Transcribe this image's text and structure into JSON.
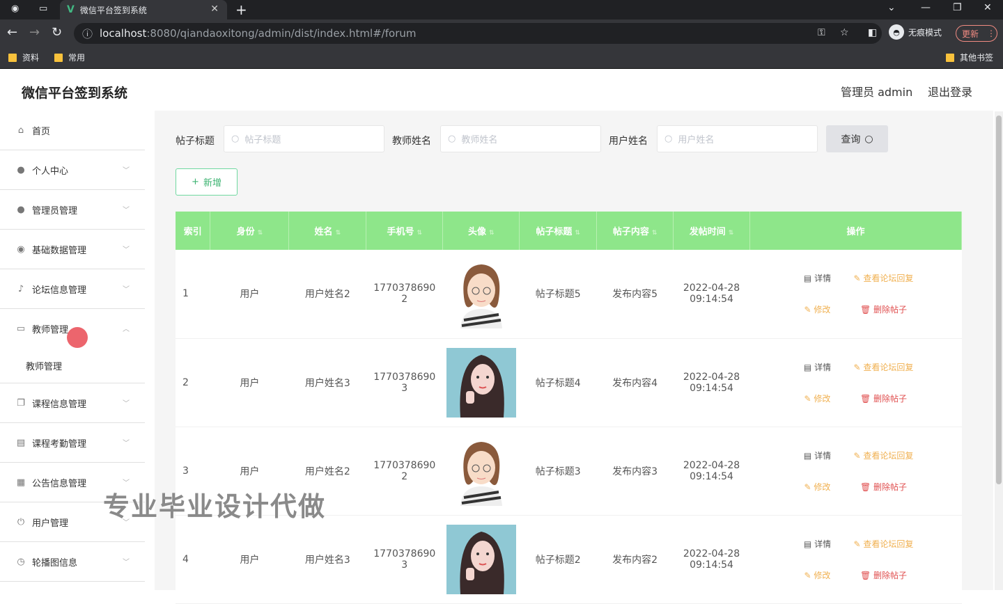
{
  "browser": {
    "tab_title": "微信平台签到系统",
    "url_host": "localhost",
    "url_rest": ":8080/qiandaoxitong/admin/dist/index.html#/forum",
    "incognito_label": "无痕模式",
    "update_label": "更新",
    "bookmarks": [
      "资料",
      "常用"
    ],
    "other_bookmarks": "其他书签"
  },
  "app": {
    "title": "微信平台签到系统",
    "user_label": "管理员 admin",
    "logout_label": "退出登录"
  },
  "sidebar": {
    "items": [
      {
        "label": "首页",
        "icon": "home-icon"
      },
      {
        "label": "个人中心",
        "icon": "user-icon"
      },
      {
        "label": "管理员管理",
        "icon": "user-icon"
      },
      {
        "label": "基础数据管理",
        "icon": "pin-icon"
      },
      {
        "label": "论坛信息管理",
        "icon": "mic-icon"
      },
      {
        "label": "教师管理",
        "icon": "chat-icon"
      },
      {
        "label": "课程信息管理",
        "icon": "copy-icon"
      },
      {
        "label": "课程考勤管理",
        "icon": "clipboard-icon"
      },
      {
        "label": "公告信息管理",
        "icon": "grid-icon"
      },
      {
        "label": "用户管理",
        "icon": "power-icon"
      },
      {
        "label": "轮播图信息",
        "icon": "clock-icon"
      }
    ],
    "submenu_label": "教师管理"
  },
  "filters": {
    "title_label": "帖子标题",
    "title_placeholder": "帖子标题",
    "teacher_label": "教师姓名",
    "teacher_placeholder": "教师姓名",
    "user_label": "用户姓名",
    "user_placeholder": "用户姓名",
    "query_label": "查询",
    "add_label": "新增"
  },
  "table": {
    "headers": [
      "索引",
      "身份",
      "姓名",
      "手机号",
      "头像",
      "帖子标题",
      "帖子内容",
      "发帖时间",
      "操作"
    ],
    "rows": [
      {
        "idx": "1",
        "role": "用户",
        "name": "用户姓名2",
        "phone1": "1770378690",
        "phone2": "2",
        "title": "帖子标题5",
        "content": "发布内容5",
        "date": "2022-04-28",
        "time": "09:14:54",
        "avatar": "cartoon"
      },
      {
        "idx": "2",
        "role": "用户",
        "name": "用户姓名3",
        "phone1": "1770378690",
        "phone2": "3",
        "title": "帖子标题4",
        "content": "发布内容4",
        "date": "2022-04-28",
        "time": "09:14:54",
        "avatar": "photo"
      },
      {
        "idx": "3",
        "role": "用户",
        "name": "用户姓名2",
        "phone1": "1770378690",
        "phone2": "2",
        "title": "帖子标题3",
        "content": "发布内容3",
        "date": "2022-04-28",
        "time": "09:14:54",
        "avatar": "cartoon"
      },
      {
        "idx": "4",
        "role": "用户",
        "name": "用户姓名3",
        "phone1": "1770378690",
        "phone2": "3",
        "title": "帖子标题2",
        "content": "发布内容2",
        "date": "2022-04-28",
        "time": "09:14:54",
        "avatar": "photo"
      }
    ],
    "ops": {
      "detail": "详情",
      "view_reply": "查看论坛回复",
      "edit": "修改",
      "delete": "删除帖子"
    }
  },
  "watermark": "专业毕业设计代做"
}
